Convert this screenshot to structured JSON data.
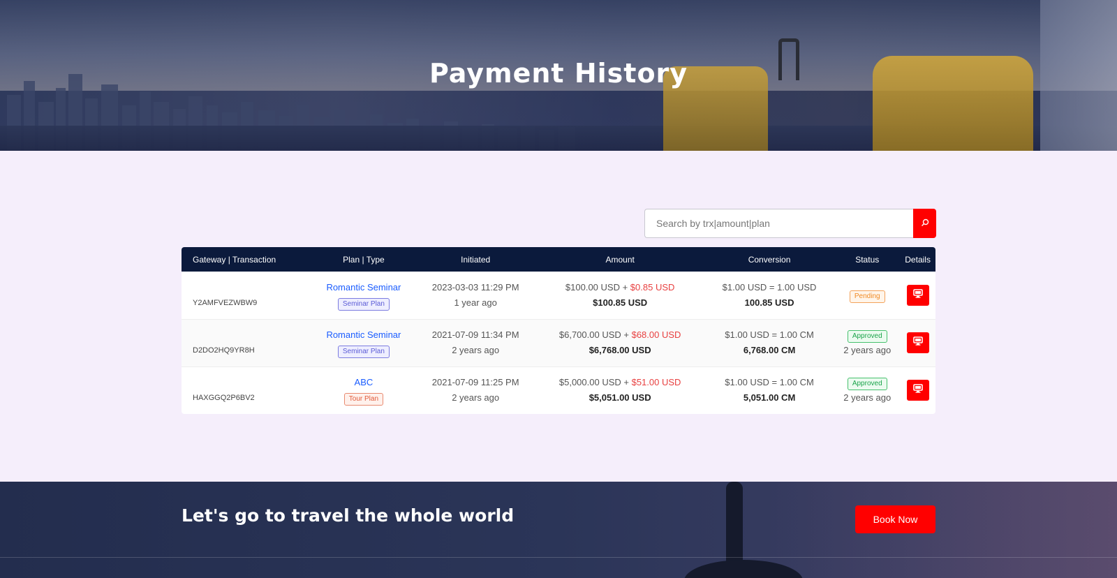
{
  "hero": {
    "title": "Payment History"
  },
  "search": {
    "placeholder": "Search by trx|amount|plan"
  },
  "table": {
    "headers": [
      "Gateway | Transaction",
      "Plan | Type",
      "Initiated",
      "Amount",
      "Conversion",
      "Status",
      "Details"
    ],
    "rows": [
      {
        "trx": "Y2AMFVEZWBW9",
        "plan": "Romantic Seminar",
        "plan_type": "Seminar Plan",
        "initiated_date": "2023-03-03 11:29 PM",
        "initiated_ago": "1 year ago",
        "amount_base": "$100.00 USD + ",
        "amount_charge": "$0.85 USD",
        "amount_total": "$100.85 USD",
        "conversion_rate": "$1.00 USD = 1.00 USD",
        "conversion_total": "100.85 USD",
        "status": "Pending",
        "status_ago": ""
      },
      {
        "trx": "D2DO2HQ9YR8H",
        "plan": "Romantic Seminar",
        "plan_type": "Seminar Plan",
        "initiated_date": "2021-07-09 11:34 PM",
        "initiated_ago": "2 years ago",
        "amount_base": "$6,700.00 USD + ",
        "amount_charge": "$68.00 USD",
        "amount_total": "$6,768.00 USD",
        "conversion_rate": "$1.00 USD = 1.00 CM",
        "conversion_total": "6,768.00 CM",
        "status": "Approved",
        "status_ago": "2 years ago"
      },
      {
        "trx": "HAXGGQ2P6BV2",
        "plan": "ABC",
        "plan_type": "Tour Plan",
        "initiated_date": "2021-07-09 11:25 PM",
        "initiated_ago": "2 years ago",
        "amount_base": "$5,000.00 USD + ",
        "amount_charge": "$51.00 USD",
        "amount_total": "$5,051.00 USD",
        "conversion_rate": "$1.00 USD = 1.00 CM",
        "conversion_total": "5,051.00 CM",
        "status": "Approved",
        "status_ago": "2 years ago"
      }
    ]
  },
  "cta": {
    "title": "Let's go to travel the whole world",
    "button": "Book Now"
  },
  "colors": {
    "accent": "#ff0000",
    "header_bg": "#0b1a3c",
    "link": "#1a5cff"
  },
  "icons": {
    "search": "search-icon",
    "details": "desktop-icon"
  }
}
